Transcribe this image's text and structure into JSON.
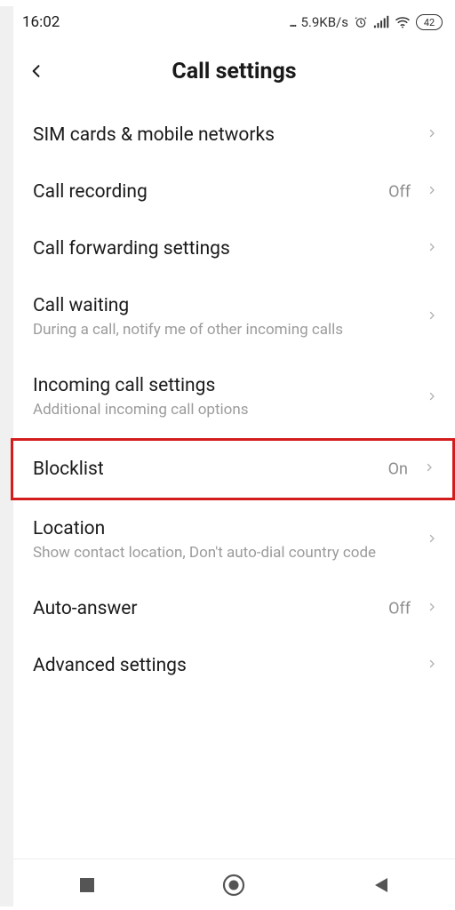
{
  "status": {
    "time": "16:02",
    "dots": "...",
    "speed": "5.9KB/s",
    "battery": "42"
  },
  "header": {
    "title": "Call settings"
  },
  "rows": {
    "sim": {
      "label": "SIM cards & mobile networks"
    },
    "recording": {
      "label": "Call recording",
      "value": "Off"
    },
    "forwarding": {
      "label": "Call forwarding settings"
    },
    "waiting": {
      "label": "Call waiting",
      "sub": "During a call, notify me of other incoming calls"
    },
    "incoming": {
      "label": "Incoming call settings",
      "sub": "Additional incoming call options"
    },
    "blocklist": {
      "label": "Blocklist",
      "value": "On"
    },
    "location": {
      "label": "Location",
      "sub": "Show contact location, Don't auto-dial country code"
    },
    "autoanswer": {
      "label": "Auto-answer",
      "value": "Off"
    },
    "advanced": {
      "label": "Advanced settings"
    }
  }
}
